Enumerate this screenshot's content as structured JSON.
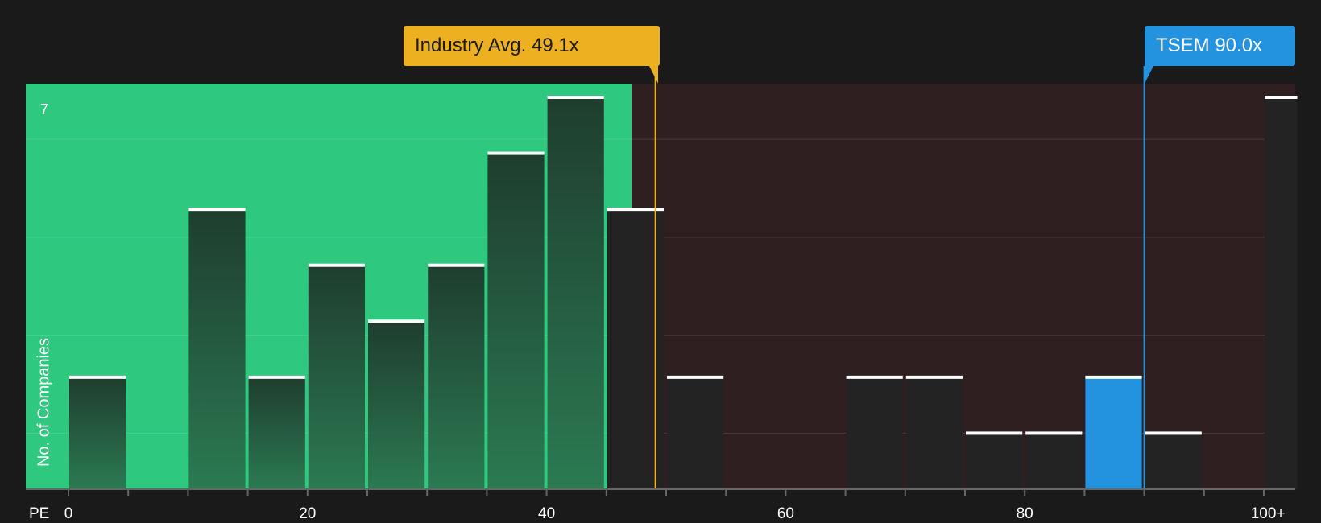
{
  "chart_data": {
    "type": "bar",
    "xlabel": "PE",
    "ylabel": "No. of Companies",
    "ymax_label": "7",
    "ylim": [
      0,
      7
    ],
    "xlim": [
      0,
      103
    ],
    "x_ticks": [
      "0",
      "20",
      "40",
      "60",
      "80",
      "100+"
    ],
    "x_tick_values": [
      0,
      20,
      40,
      60,
      80,
      100
    ],
    "bins": [
      {
        "start": 0,
        "end": 5,
        "count": 2
      },
      {
        "start": 5,
        "end": 10,
        "count": 0
      },
      {
        "start": 10,
        "end": 15,
        "count": 5
      },
      {
        "start": 15,
        "end": 20,
        "count": 2
      },
      {
        "start": 20,
        "end": 25,
        "count": 4
      },
      {
        "start": 25,
        "end": 30,
        "count": 3
      },
      {
        "start": 30,
        "end": 35,
        "count": 4
      },
      {
        "start": 35,
        "end": 40,
        "count": 6
      },
      {
        "start": 40,
        "end": 45,
        "count": 7
      },
      {
        "start": 45,
        "end": 50,
        "count": 5
      },
      {
        "start": 50,
        "end": 55,
        "count": 2
      },
      {
        "start": 55,
        "end": 60,
        "count": 0
      },
      {
        "start": 60,
        "end": 65,
        "count": 0
      },
      {
        "start": 65,
        "end": 70,
        "count": 2
      },
      {
        "start": 70,
        "end": 75,
        "count": 2
      },
      {
        "start": 75,
        "end": 80,
        "count": 1
      },
      {
        "start": 80,
        "end": 85,
        "count": 1
      },
      {
        "start": 85,
        "end": 90,
        "count": 2,
        "highlight": true
      },
      {
        "start": 90,
        "end": 95,
        "count": 1
      },
      {
        "start": 95,
        "end": 100,
        "count": 0
      },
      {
        "start": 100,
        "end": 103,
        "count": 7
      }
    ],
    "industry_avg": {
      "value": 49.1,
      "label": "Industry Avg. 49.1x"
    },
    "company": {
      "name": "TSEM",
      "value": 90.0,
      "label": "TSEM 90.0x"
    },
    "grid": true,
    "colors": {
      "fair_zone": "#2ec97e",
      "over_zone": "#2f1f20",
      "bar": "#244a37",
      "bar_dark": "#232323",
      "highlight_bar": "#2393e0",
      "industry": "#ecb020",
      "company": "#2393e0"
    }
  }
}
